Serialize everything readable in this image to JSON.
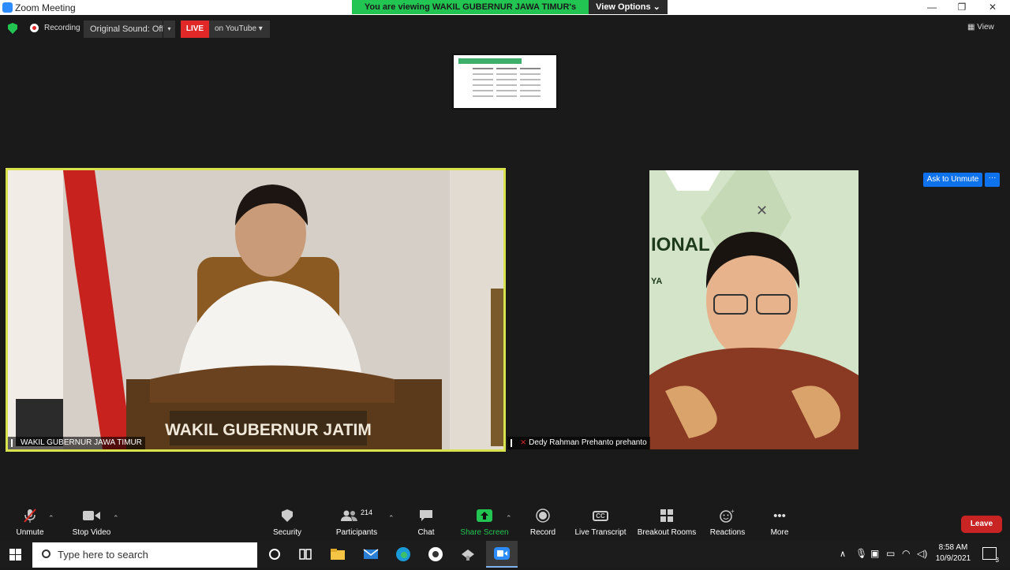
{
  "window": {
    "title": "Zoom Meeting",
    "minimize_glyph": "—",
    "restore_glyph": "❐",
    "close_glyph": "✕"
  },
  "banner": {
    "viewing_text": "You are viewing WAKIL GUBERNUR JAWA TIMUR's screen",
    "view_options_label": "View Options ⌄"
  },
  "infobar": {
    "recording_label": "Recording",
    "original_sound_label": "Original Sound: Off",
    "live_label": "LIVE",
    "streaming_label": "on YouTube ▾",
    "view_label": "View"
  },
  "tiles": {
    "left_name": "WAKIL GUBERNUR JAWA TIMUR",
    "left_nameplate": "WAKIL GUBERNUR JATIM",
    "right_name": "Dedy Rahman Prehanto prehanto",
    "right_bg_text_1": "IONAL",
    "right_bg_text_2": "YA",
    "ask_to_unmute_label": "Ask to Unmute",
    "more_label": "···"
  },
  "toolbar": {
    "unmute_label": "Unmute",
    "stop_video_label": "Stop Video",
    "security_label": "Security",
    "participants_label": "Participants",
    "participants_count": "214",
    "chat_label": "Chat",
    "share_screen_label": "Share Screen",
    "record_label": "Record",
    "live_transcript_label": "Live Transcript",
    "cc_glyph": "CC",
    "breakout_rooms_label": "Breakout Rooms",
    "reactions_label": "Reactions",
    "more_label": "More",
    "leave_label": "Leave"
  },
  "taskbar": {
    "search_placeholder": "Type here to search",
    "time": "8:58 AM",
    "date": "10/9/2021",
    "notification_count": "3"
  },
  "colors": {
    "accent_green": "#23c552",
    "live_red": "#e02828",
    "button_blue": "#0e72ed",
    "active_speaker_border": "#d7e24c",
    "leave_red": "#c82424"
  }
}
